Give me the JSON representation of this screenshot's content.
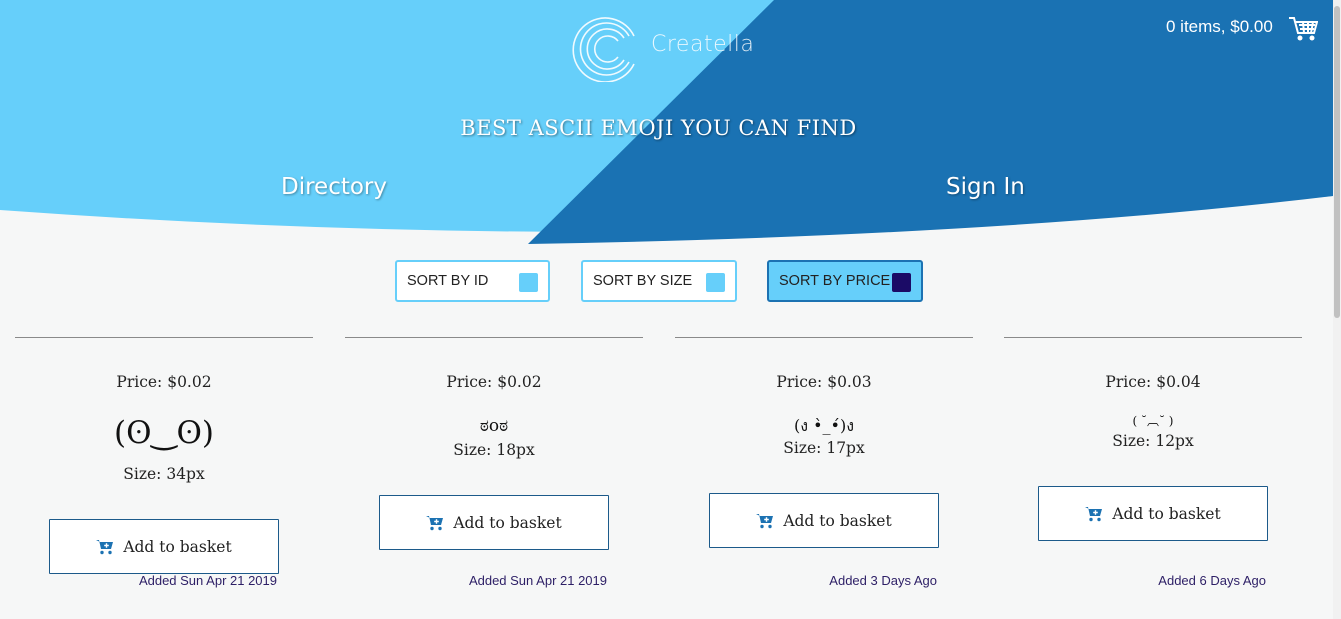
{
  "header": {
    "brand": "Creatella",
    "cart_summary": "0 items, $0.00",
    "tagline": "BEST ASCII EMOJI YOU CAN FIND",
    "colors": {
      "light": "#66cffa",
      "dark": "#1a72b3"
    }
  },
  "nav": {
    "directory": "Directory",
    "sign_in": "Sign In"
  },
  "sort": {
    "by_id": "SORT BY ID",
    "by_size": "SORT BY SIZE",
    "by_price": "SORT BY PRICE",
    "active": "SORT BY PRICE"
  },
  "products": [
    {
      "price": "Price: $0.02",
      "face": "(ʘ‿ʘ)",
      "size": "Size: 34px",
      "button": "Add to basket",
      "added": "Added Sun Apr 21 2019"
    },
    {
      "price": "Price: $0.02",
      "face": "ಠoಠ",
      "size": "Size: 18px",
      "button": "Add to basket",
      "added": "Added Sun Apr 21 2019"
    },
    {
      "price": "Price: $0.03",
      "face": "(ง •̀_•́)ง",
      "size": "Size: 17px",
      "button": "Add to basket",
      "added": "Added 3 Days Ago"
    },
    {
      "price": "Price: $0.04",
      "face": "( ˘︹˘ )",
      "size": "Size: 12px",
      "button": "Add to basket",
      "added": "Added 6 Days Ago"
    }
  ]
}
